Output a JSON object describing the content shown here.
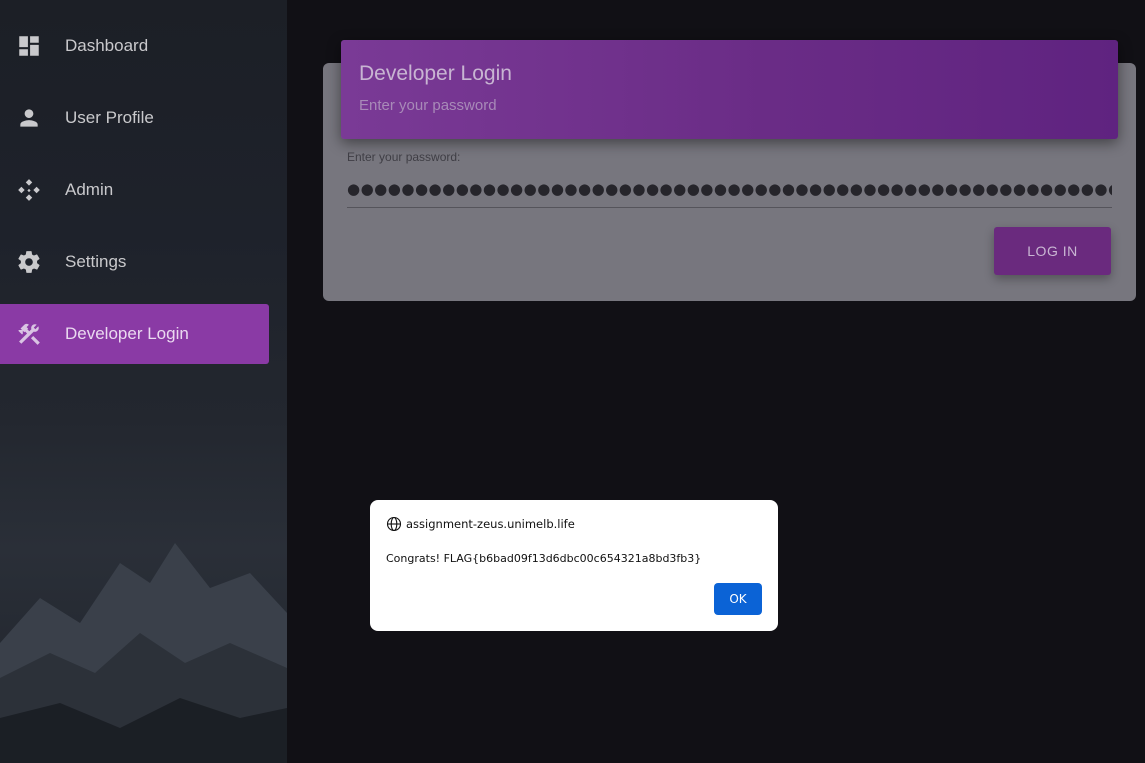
{
  "sidebar": {
    "items": [
      {
        "label": "Dashboard",
        "icon": "dashboard-icon"
      },
      {
        "label": "User Profile",
        "icon": "person-icon"
      },
      {
        "label": "Admin",
        "icon": "admin-icon"
      },
      {
        "label": "Settings",
        "icon": "gear-icon"
      },
      {
        "label": "Developer Login",
        "icon": "build-icon",
        "active": true
      }
    ]
  },
  "card": {
    "title": "Developer Login",
    "subtitle": "Enter your password",
    "password_label": "Enter your password:",
    "password_value": "●●●●●●●●●●●●●●●●●●●●●●●●●●●●●●●●●●●●●●●●●●●●●●●●●●●●●●●●●●●●●●●●●●●●●●●●●●",
    "login_button": "LOG IN"
  },
  "dialog": {
    "origin": "assignment-zeus.unimelb.life",
    "message": "Congrats! FLAG{b6bad09f13d6dbc00c654321a8bd3fb3}",
    "ok_button": "OK"
  },
  "colors": {
    "accent": "#8a3aa5",
    "ok_button": "#0b63d6"
  }
}
